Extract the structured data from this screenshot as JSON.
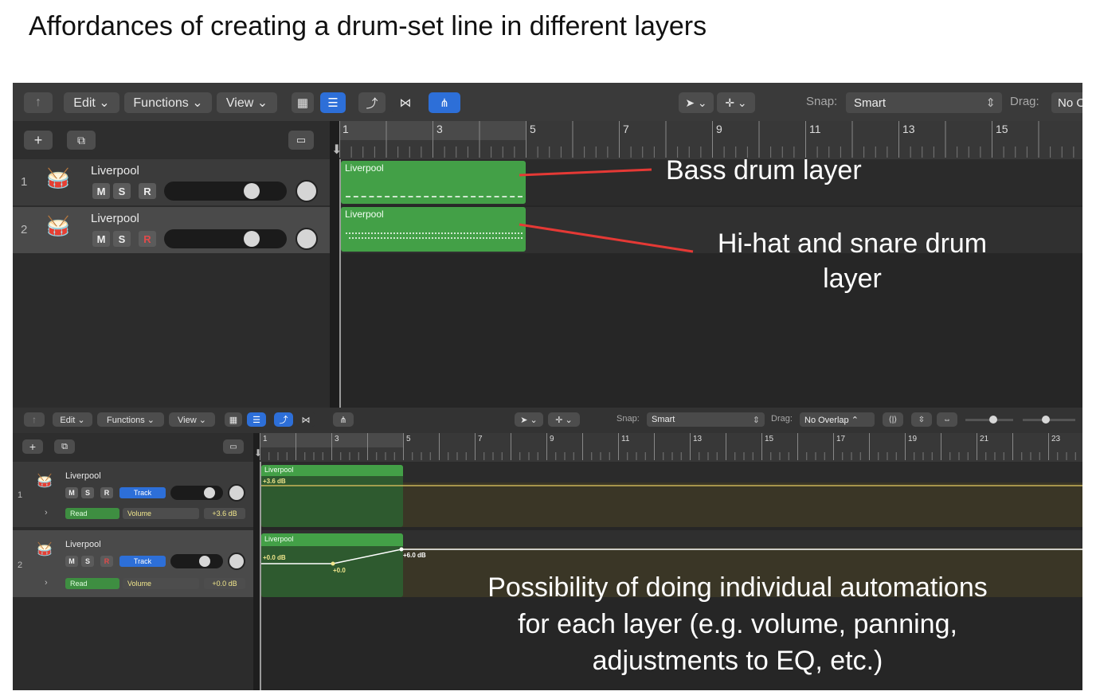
{
  "title": "Affordances of creating a drum-set line in different layers",
  "toolbar_top": {
    "edit": "Edit ⌄",
    "functions": "Functions ⌄",
    "view": "View ⌄",
    "snap_label": "Snap:",
    "snap_value": "Smart",
    "drag_label": "Drag:",
    "drag_value": "No O"
  },
  "toolbar_bottom": {
    "edit": "Edit ⌄",
    "functions": "Functions ⌄",
    "view": "View ⌄",
    "snap_label": "Snap:",
    "snap_value": "Smart",
    "drag_label": "Drag:",
    "drag_value": "No Overlap ⌃"
  },
  "ruler_top": [
    "1",
    "3",
    "5",
    "7",
    "9",
    "11",
    "13",
    "15"
  ],
  "ruler_bottom": [
    "1",
    "3",
    "5",
    "7",
    "9",
    "11",
    "13",
    "15",
    "17",
    "19",
    "21",
    "23"
  ],
  "tracks_top": [
    {
      "num": "1",
      "name": "Liverpool",
      "m": "M",
      "s": "S",
      "r": "R",
      "region": "Liverpool",
      "volume_level": 0.8
    },
    {
      "num": "2",
      "name": "Liverpool",
      "m": "M",
      "s": "S",
      "r": "R",
      "region": "Liverpool",
      "volume_level": 0.8
    }
  ],
  "tracks_bottom": [
    {
      "num": "1",
      "name": "Liverpool",
      "m": "M",
      "s": "S",
      "r": "R",
      "track": "Track",
      "mode": "Read",
      "param": "Volume",
      "value": "+3.6 dB",
      "region": "Liverpool",
      "region_value": "+3.6 dB"
    },
    {
      "num": "2",
      "name": "Liverpool",
      "m": "M",
      "s": "S",
      "r": "R",
      "track": "Track",
      "mode": "Read",
      "param": "Volume",
      "value": "+0.0 dB",
      "region": "Liverpool",
      "region_value": "+0.0 dB",
      "point1": "+0.0",
      "point2": "+6.0 dB"
    }
  ],
  "annotations": {
    "bass": "Bass drum layer",
    "hihat_line1": "Hi-hat and snare drum",
    "hihat_line2": "layer",
    "auto_line1": "Possibility of doing individual automations",
    "auto_line2": "for each layer (e.g. volume, panning,",
    "auto_line3": "adjustments to EQ, etc.)"
  },
  "colors": {
    "region_green": "#43a047",
    "annotation_arrow": "#e53935",
    "automation_line": "#f0e68c",
    "selected_blue": "#2d6fd8"
  },
  "icons": [
    "back-arrow-icon",
    "grid-icon",
    "list-icon",
    "pencil-curve-icon",
    "bowtie-icon",
    "split-tool-icon",
    "pointer-tool-icon",
    "crosshair-tool-icon",
    "plus-icon",
    "duplicate-icon",
    "collapse-icon",
    "drum-kit-icon",
    "chevron-right-icon"
  ]
}
